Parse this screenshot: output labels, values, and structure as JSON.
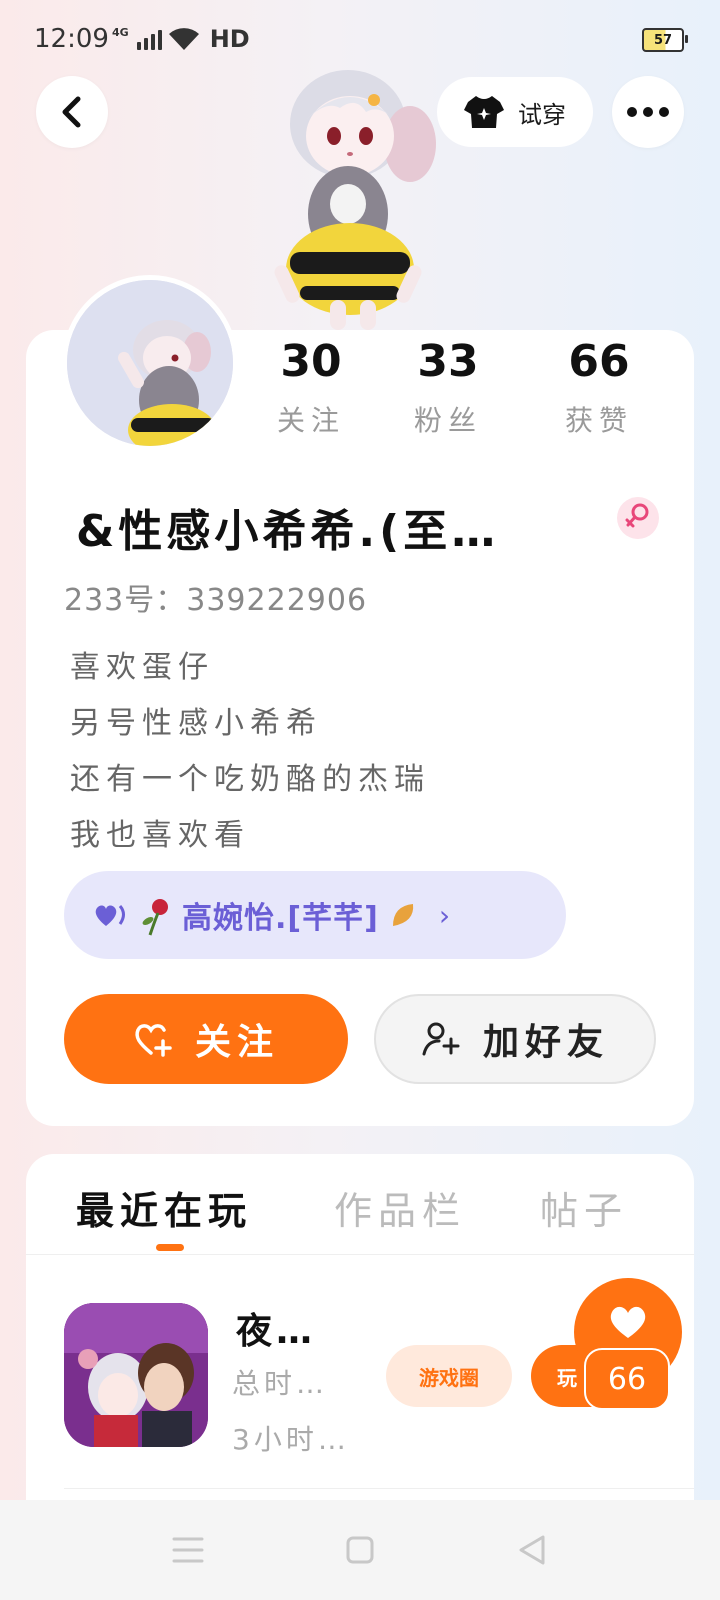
{
  "status_bar": {
    "time": "12:09",
    "network": "4G",
    "hd": "HD",
    "battery": "57"
  },
  "header": {
    "back_icon": "chevron-left-icon",
    "try_on_label": "试穿",
    "more_icon": "more-dots-icon"
  },
  "profile": {
    "stats": [
      {
        "value": "30",
        "label": "关注"
      },
      {
        "value": "33",
        "label": "粉丝"
      },
      {
        "value": "66",
        "label": "获赞"
      }
    ],
    "nickname": "&性感小希希.(至…",
    "gender": "female",
    "id_line": "233号：339222906",
    "bio": [
      "喜欢蛋仔",
      "另号性感小希希",
      "还有一个吃奶酪的杰瑞",
      "我也喜欢看"
    ],
    "relation": {
      "text": "高婉怡.[芊芊]",
      "chevron": "›"
    },
    "follow_label": "关注",
    "add_friend_label": "加好友"
  },
  "tabs": [
    {
      "label": "最近在玩",
      "active": true
    },
    {
      "label": "作品栏",
      "active": false
    },
    {
      "label": "帖子",
      "active": false
    }
  ],
  "recent_games": [
    {
      "title": "夜…",
      "total_time": "总时…",
      "recent_time": "3小时…",
      "tag": "游戏圈",
      "play_label": "玩"
    }
  ],
  "like_fab": {
    "count": "66"
  },
  "colors": {
    "accent": "#ff7212",
    "relation_bg": "#e7e7fb",
    "relation_text": "#6b5fd6",
    "gender_bg": "#fde3ea",
    "gender_icon": "#e8477a"
  }
}
